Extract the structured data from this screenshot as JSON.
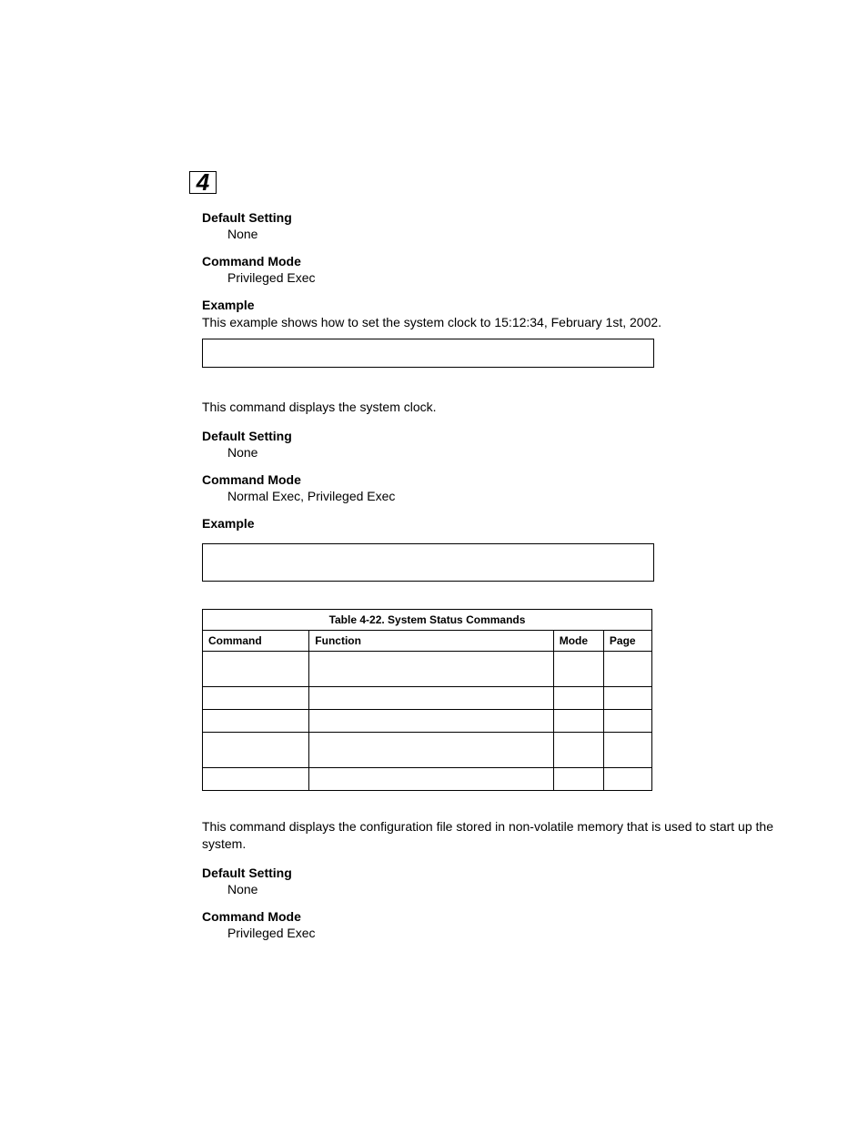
{
  "chapter_number": "4",
  "sections": {
    "s1": {
      "default_setting_label": "Default Setting",
      "default_setting_value": "None",
      "command_mode_label": "Command Mode",
      "command_mode_value": "Privileged Exec",
      "example_label": "Example",
      "example_intro": "This example shows how to set the system clock to 15:12:34, February 1st, 2002."
    },
    "s2": {
      "intro": "This command displays the system clock.",
      "default_setting_label": "Default Setting",
      "default_setting_value": "None",
      "command_mode_label": "Command Mode",
      "command_mode_value": "Normal Exec, Privileged Exec",
      "example_label": "Example"
    },
    "s3": {
      "intro": "This command displays the configuration file stored in non-volatile memory that is used to start up the system.",
      "default_setting_label": "Default Setting",
      "default_setting_value": "None",
      "command_mode_label": "Command Mode",
      "command_mode_value": "Privileged Exec"
    }
  },
  "table": {
    "title": "Table 4-22.  System Status Commands",
    "headers": {
      "command": "Command",
      "function": "Function",
      "mode": "Mode",
      "page": "Page"
    },
    "rows": [
      {
        "command": "",
        "function": "",
        "mode": "",
        "page": "",
        "height": "big"
      },
      {
        "command": "",
        "function": "",
        "mode": "",
        "page": "",
        "height": "small"
      },
      {
        "command": "",
        "function": "",
        "mode": "",
        "page": "",
        "height": "small"
      },
      {
        "command": "",
        "function": "",
        "mode": "",
        "page": "",
        "height": "big"
      },
      {
        "command": "",
        "function": "",
        "mode": "",
        "page": "",
        "height": "small"
      }
    ]
  }
}
